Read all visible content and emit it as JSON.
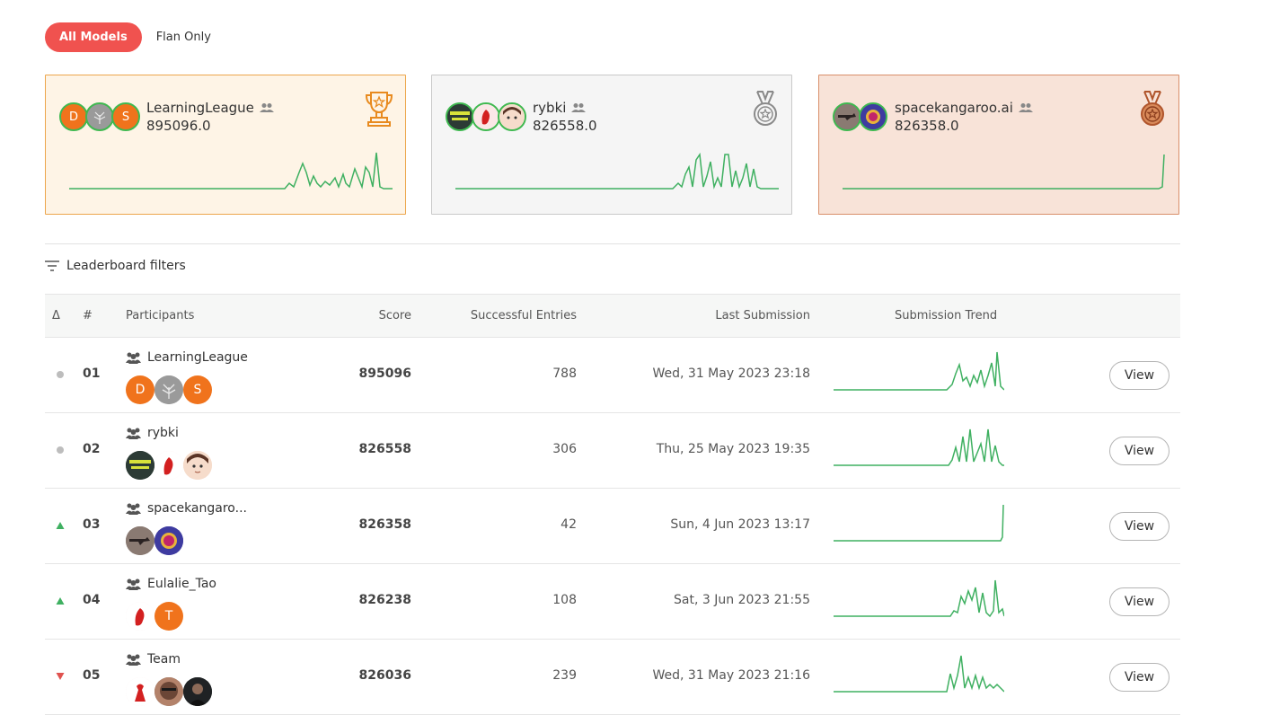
{
  "tabs": {
    "all_models": "All Models",
    "flan_only": "Flan Only"
  },
  "podium": [
    {
      "name": "LearningLeague",
      "score": "895096.0",
      "medal": "gold-trophy",
      "avatars": [
        {
          "kind": "letter",
          "text": "D",
          "color": "orange"
        },
        {
          "kind": "image",
          "color": "gray"
        },
        {
          "kind": "letter",
          "text": "S",
          "color": "orange"
        }
      ]
    },
    {
      "name": "rybki",
      "score": "826558.0",
      "medal": "silver-medal",
      "avatars": [
        {
          "kind": "image",
          "color": "dark"
        },
        {
          "kind": "image",
          "color": "red"
        },
        {
          "kind": "image",
          "color": "face"
        }
      ]
    },
    {
      "name": "spacekangaroo.ai",
      "score": "826358.0",
      "medal": "bronze-medal",
      "avatars": [
        {
          "kind": "image",
          "color": "brown"
        },
        {
          "kind": "image",
          "color": "purple"
        }
      ]
    }
  ],
  "filters_label": "Leaderboard filters",
  "table": {
    "headers": {
      "delta": "Δ",
      "rank": "#",
      "participants": "Participants",
      "score": "Score",
      "entries": "Successful Entries",
      "last": "Last Submission",
      "trend": "Submission Trend"
    },
    "view_label": "View",
    "rows": [
      {
        "delta": "same",
        "rank": "01",
        "name": "LearningLeague",
        "score": "895096",
        "entries": "788",
        "last": "Wed, 31 May 2023 23:18",
        "avatars": [
          {
            "kind": "letter",
            "text": "D",
            "color": "orange"
          },
          {
            "kind": "image",
            "color": "gray"
          },
          {
            "kind": "letter",
            "text": "S",
            "color": "orange"
          }
        ]
      },
      {
        "delta": "same",
        "rank": "02",
        "name": "rybki",
        "score": "826558",
        "entries": "306",
        "last": "Thu, 25 May 2023 19:35",
        "avatars": [
          {
            "kind": "image",
            "color": "dark"
          },
          {
            "kind": "image",
            "color": "red"
          },
          {
            "kind": "image",
            "color": "face"
          }
        ]
      },
      {
        "delta": "up",
        "rank": "03",
        "name": "spacekangaro...",
        "score": "826358",
        "entries": "42",
        "last": "Sun, 4 Jun 2023 13:17",
        "avatars": [
          {
            "kind": "image",
            "color": "brown"
          },
          {
            "kind": "image",
            "color": "purple"
          }
        ]
      },
      {
        "delta": "up",
        "rank": "04",
        "name": "Eulalie_Tao",
        "score": "826238",
        "entries": "108",
        "last": "Sat, 3 Jun 2023 21:55",
        "avatars": [
          {
            "kind": "image",
            "color": "red"
          },
          {
            "kind": "letter",
            "text": "T",
            "color": "orange"
          }
        ]
      },
      {
        "delta": "down",
        "rank": "05",
        "name": "Team",
        "score": "826036",
        "entries": "239",
        "last": "Wed, 31 May 2023 21:16",
        "avatars": [
          {
            "kind": "image",
            "color": "red"
          },
          {
            "kind": "image",
            "color": "brown"
          },
          {
            "kind": "image",
            "color": "dark"
          }
        ]
      }
    ]
  },
  "colors": {
    "accent": "#f0524f",
    "trend": "#3fb061",
    "up": "#3fb061",
    "down": "#e0524f",
    "same": "#bdbdbd"
  }
}
